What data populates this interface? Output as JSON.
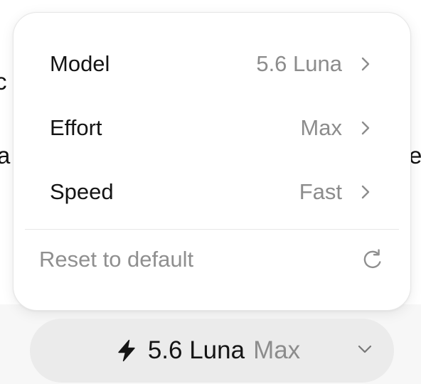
{
  "background": {
    "fragments": [
      "c",
      "a",
      "e"
    ]
  },
  "menu": {
    "items": [
      {
        "label": "Model",
        "value": "5.6 Luna",
        "icon": "chevron-right-icon"
      },
      {
        "label": "Effort",
        "value": "Max",
        "icon": "chevron-right-icon"
      },
      {
        "label": "Speed",
        "value": "Fast",
        "icon": "chevron-right-icon"
      }
    ],
    "reset": {
      "label": "Reset to default",
      "icon": "reset-icon"
    }
  },
  "selector": {
    "icon": "lightning-bolt-icon",
    "model": "5.6 Luna",
    "effort": "Max",
    "chevron_icon": "chevron-down-icon"
  },
  "colors": {
    "primary_text": "#141414",
    "secondary_text": "#8c8c8c",
    "popup_bg": "#ffffff",
    "pill_bg": "#ebebeb",
    "page_lower_bg": "#f7f7f7",
    "divider": "#e7e7e7"
  }
}
